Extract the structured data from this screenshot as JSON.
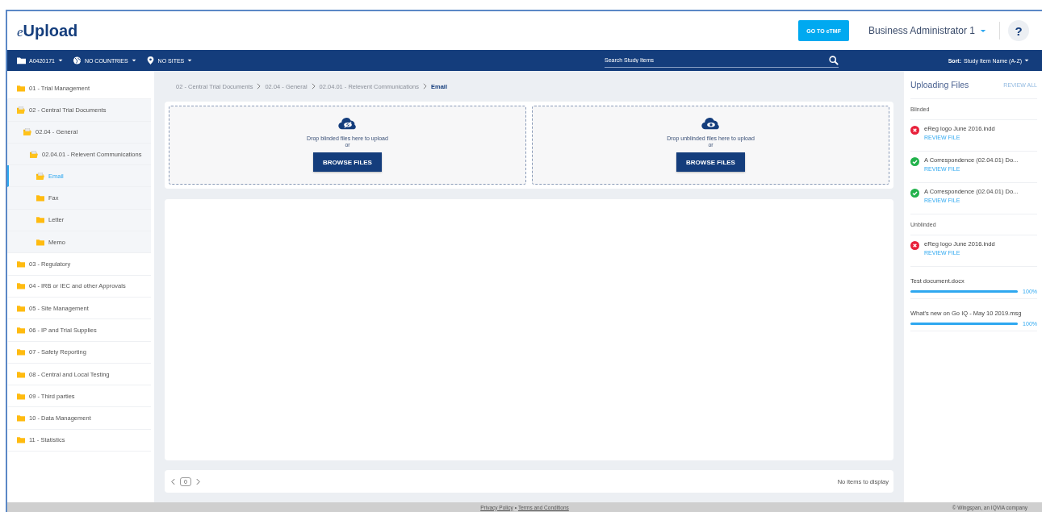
{
  "app": {
    "logo_prefix": "e",
    "logo": "Upload",
    "go_button": "GO TO eTMF",
    "user": "Business Administrator 1",
    "help": "?"
  },
  "navbar": {
    "filters": [
      {
        "kind": "folder",
        "label": "A0420171"
      },
      {
        "kind": "globe",
        "label": "NO COUNTRIES"
      },
      {
        "kind": "pin",
        "label": "NO SITES"
      }
    ],
    "search": {
      "placeholder": "Search Study Items"
    },
    "sort_label": "Sort:",
    "sort_value": "Study Item Name (A-Z)"
  },
  "tree": [
    {
      "label": "01 - Trial Management",
      "expanded": false,
      "selected": false
    },
    {
      "label": "02 - Central Trial Documents",
      "expanded": true,
      "selected": false,
      "children": [
        {
          "label": "02.04 - General",
          "expanded": true,
          "selected": false,
          "children": [
            {
              "label": "02.04.01 - Relevent Communications",
              "expanded": true,
              "selected": false,
              "children": [
                {
                  "label": "Email",
                  "expanded": false,
                  "selected": true
                },
                {
                  "label": "Fax",
                  "expanded": false,
                  "selected": false
                },
                {
                  "label": "Letter",
                  "expanded": false,
                  "selected": false
                },
                {
                  "label": "Memo",
                  "expanded": false,
                  "selected": false
                }
              ]
            }
          ]
        }
      ]
    },
    {
      "label": "03 - Regulatory",
      "expanded": false,
      "selected": false
    },
    {
      "label": "04 - IRB or IEC and other Approvals",
      "expanded": false,
      "selected": false
    },
    {
      "label": "05 - Site Management",
      "expanded": false,
      "selected": false
    },
    {
      "label": "06 - IP and Trial Supplies",
      "expanded": false,
      "selected": false
    },
    {
      "label": "07 - Safety Reporting",
      "expanded": false,
      "selected": false
    },
    {
      "label": "08 - Central and Local Testing",
      "expanded": false,
      "selected": false
    },
    {
      "label": "09 - Third parties",
      "expanded": false,
      "selected": false
    },
    {
      "label": "10 - Data Management",
      "expanded": false,
      "selected": false
    },
    {
      "label": "11 - Statistics",
      "expanded": false,
      "selected": false
    }
  ],
  "breadcrumb": [
    "02 - Central Trial Documents",
    "02.04 - General",
    "02.04.01 - Relevent Communications",
    "Email"
  ],
  "dropzones": [
    {
      "kind": "blinded",
      "text": "Drop blinded files here to upload",
      "or": "or",
      "button": "BROWSE FILES"
    },
    {
      "kind": "unblinded",
      "text": "Drop unblinded files here to upload",
      "or": "or",
      "button": "BROWSE FILES"
    }
  ],
  "pager": {
    "page": "0",
    "empty_text": "No items to display"
  },
  "uploads": {
    "title": "Uploading Files",
    "review_all": "REVIEW ALL",
    "sections": [
      {
        "title": "Blinded",
        "files": [
          {
            "kind": "error",
            "name": "eReg logo June 2016.indd",
            "action": "REVIEW FILE"
          },
          {
            "kind": "success",
            "name": "A Correspondence (02.04.01) Do...",
            "action": "REVIEW FILE"
          },
          {
            "kind": "success",
            "name": "A Correspondence (02.04.01) Do...",
            "action": "REVIEW FILE"
          }
        ]
      },
      {
        "title": "Unblinded",
        "files": [
          {
            "kind": "error",
            "name": "eReg logo June 2016.indd",
            "action": "REVIEW FILE"
          },
          {
            "kind": "progress",
            "name": "Test document.docx",
            "level": 1,
            "percent": "100%"
          },
          {
            "kind": "progress",
            "name": "What's new on Go IQ - May 10 2019.msg",
            "level": 1,
            "percent": "100%"
          }
        ]
      }
    ]
  },
  "footer": {
    "links": [
      "Privacy Policy",
      "Terms and Conditions"
    ],
    "separator": "•",
    "copyright": "© Wingspan, an IQVIA company"
  }
}
